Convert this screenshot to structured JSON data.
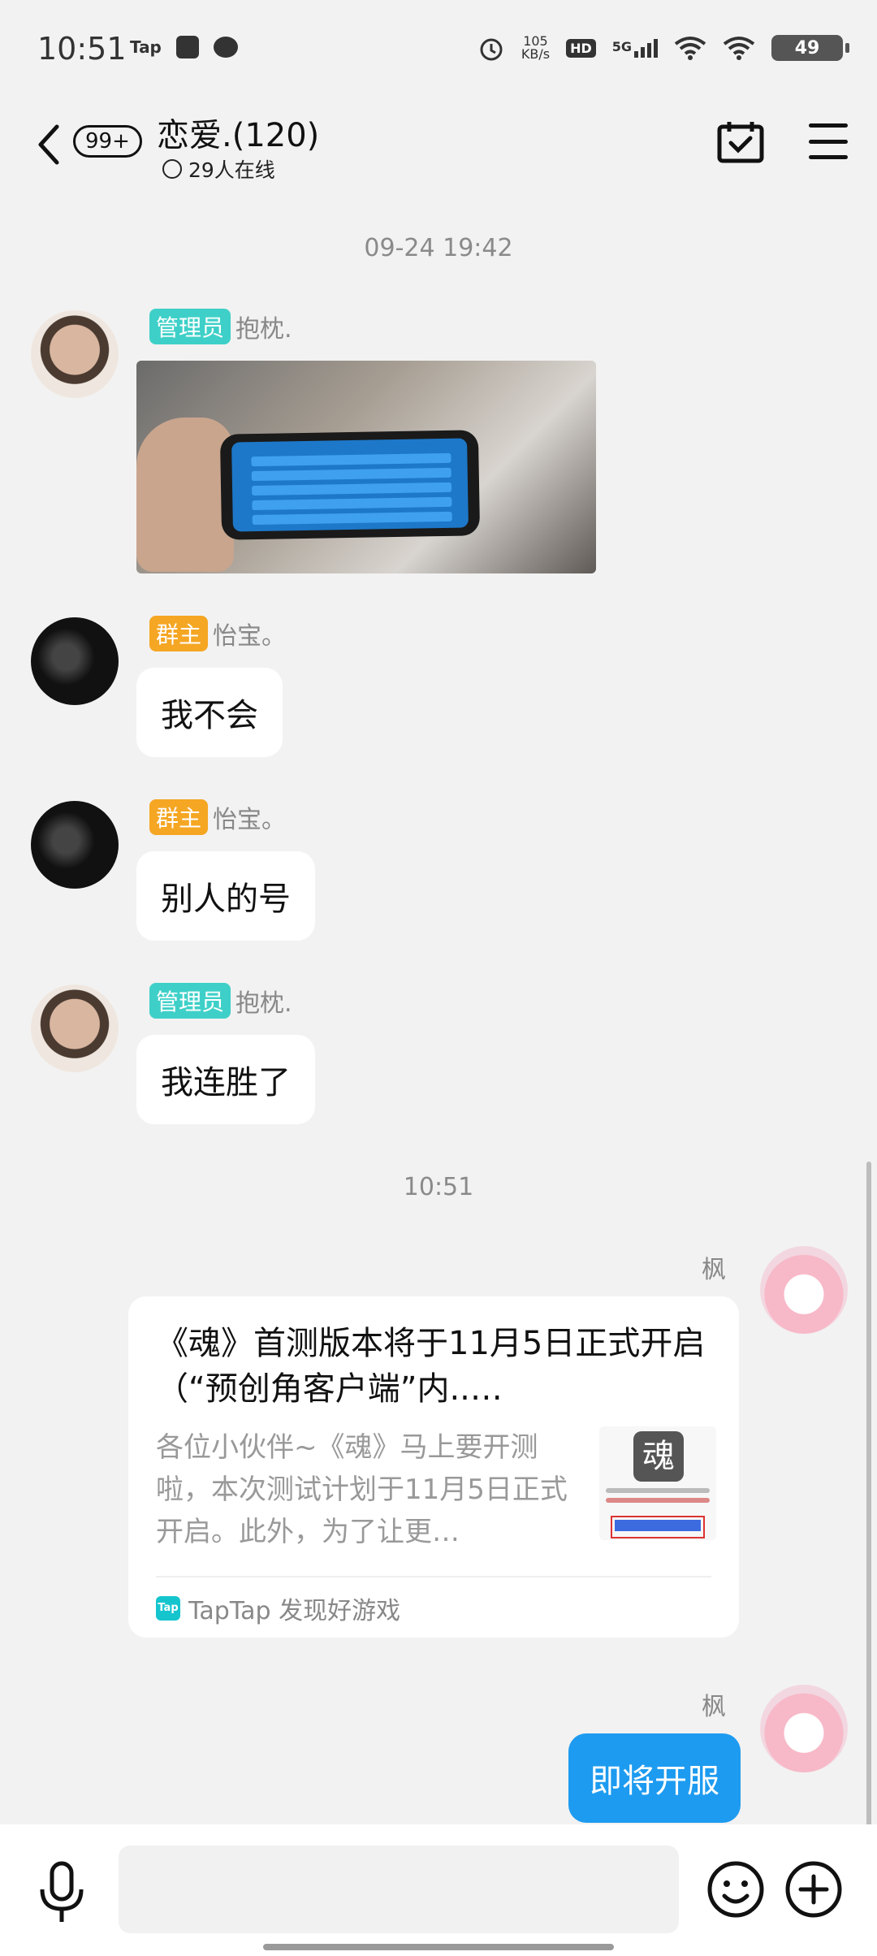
{
  "status_bar": {
    "time": "10:51",
    "tap_label": "Tap",
    "net_speed_value": "105",
    "net_speed_unit": "KB/s",
    "hd": "HD",
    "signal": "5G",
    "battery": "49"
  },
  "header": {
    "unread_badge": "99+",
    "title": "恋爱.(120)",
    "online": "29人在线"
  },
  "messages": [
    {
      "type": "timestamp",
      "text": "09-24 19:42"
    },
    {
      "role": "管理员",
      "sender": "抱枕.",
      "content_type": "image"
    },
    {
      "role": "群主",
      "sender": "怡宝。",
      "text": "我不会"
    },
    {
      "role": "群主",
      "sender": "怡宝。",
      "text": "别人的号"
    },
    {
      "role": "管理员",
      "sender": "抱枕.",
      "text": "我连胜了"
    },
    {
      "type": "timestamp",
      "text": "10:51"
    },
    {
      "sender": "枫",
      "card": {
        "title": "《魂》首测版本将于11月5日正式开启（“预创角客户端”内..…",
        "description": "各位小伙伴~《魂》马上要开测啦，本次测试计划于11月5日正式开启。此外，为了让更…",
        "thumb_char": "魂",
        "source_logo": "Tap",
        "source": "TapTap 发现好游戏"
      }
    },
    {
      "sender": "枫",
      "text": "即将开服"
    }
  ],
  "input": {
    "placeholder": ""
  },
  "colors": {
    "background": "#f2f2f2",
    "admin_tag": "#3ed0c8",
    "owner_tag": "#f5a623",
    "self_bubble": "#1d9bf0",
    "taptap_brand": "#15c5ce"
  },
  "icons": [
    "back-icon",
    "calendar-check-icon",
    "menu-icon",
    "mic-icon",
    "emoji-icon",
    "plus-circle-icon"
  ]
}
